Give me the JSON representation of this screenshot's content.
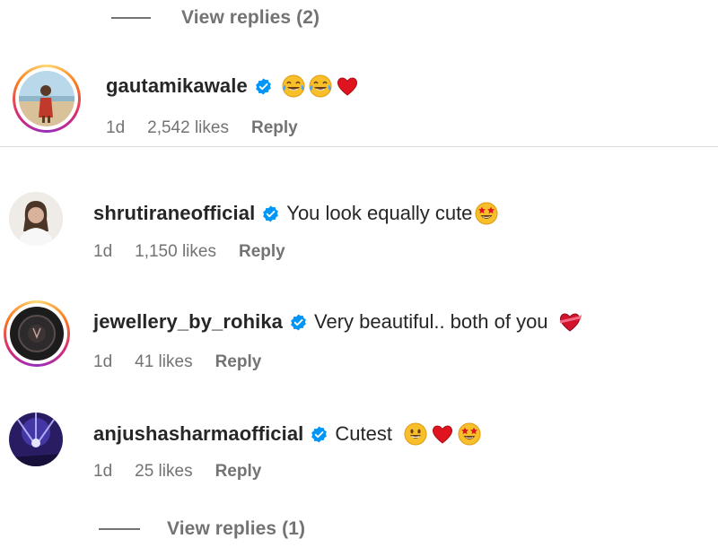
{
  "top_replies": {
    "label": "View replies (2)"
  },
  "bottom_replies": {
    "label": "View replies (1)"
  },
  "comments": [
    {
      "username": "gautamikawale",
      "verified": true,
      "text": "",
      "emojis": [
        "tears-of-joy",
        "tears-of-joy",
        "red-heart"
      ],
      "time": "1d",
      "likes": "2,542 likes",
      "reply": "Reply",
      "story_ring": true
    },
    {
      "username": "shrutiraneofficial",
      "verified": true,
      "text": "You look equally cute",
      "emojis": [
        "star-struck"
      ],
      "time": "1d",
      "likes": "1,150 likes",
      "reply": "Reply",
      "story_ring": false
    },
    {
      "username": "jewellery_by_rohika",
      "verified": true,
      "text": "Very beautiful.. both of you",
      "emojis": [
        "heart-with-ribbon"
      ],
      "time": "1d",
      "likes": "41 likes",
      "reply": "Reply",
      "story_ring": true
    },
    {
      "username": "anjushasharmaofficial",
      "verified": true,
      "text": "Cutest",
      "emojis": [
        "grinning-face",
        "red-heart",
        "star-struck"
      ],
      "time": "1d",
      "likes": "25 likes",
      "reply": "Reply",
      "story_ring": false
    }
  ],
  "colors": {
    "verified_blue": "#0095f6",
    "secondary_text": "#737373",
    "primary_text": "#262626"
  }
}
